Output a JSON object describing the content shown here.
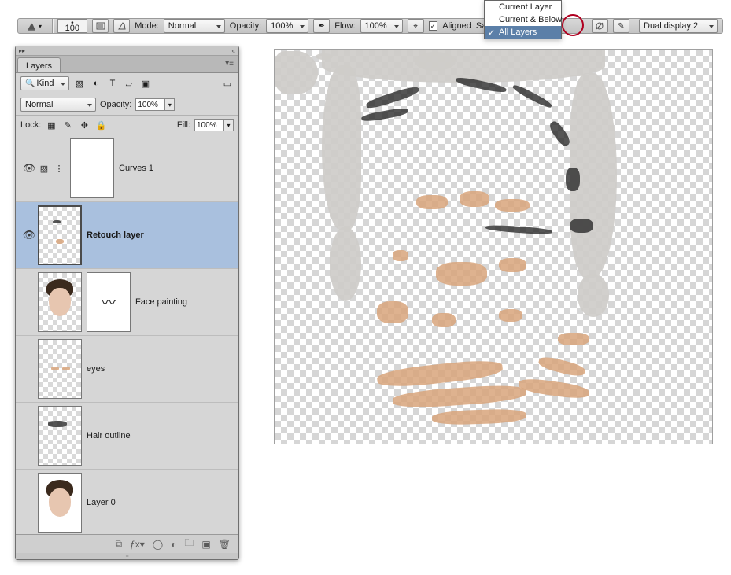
{
  "options_bar": {
    "brush_size": "100",
    "mode_label": "Mode:",
    "mode_value": "Normal",
    "opacity_label": "Opacity:",
    "opacity_value": "100%",
    "flow_label": "Flow:",
    "flow_value": "100%",
    "aligned_checked": true,
    "aligned_label": "Aligned",
    "sample_label": "Sample:",
    "sample_value": "All Layers",
    "sample_options": [
      "Current Layer",
      "Current & Below",
      "All Layers"
    ],
    "display_select": "Dual display 2"
  },
  "layers_panel": {
    "tab_label": "Layers",
    "filter": {
      "kind_label": "Kind",
      "icons": [
        "image",
        "adjust",
        "text",
        "shape",
        "smart"
      ]
    },
    "blend": {
      "mode": "Normal",
      "opacity_label": "Opacity:",
      "opacity_value": "100%"
    },
    "lock": {
      "label": "Lock:",
      "fill_label": "Fill:",
      "fill_value": "100%"
    },
    "layers": [
      {
        "name": "Curves 1",
        "visible": true,
        "type": "adjustment",
        "mask": true
      },
      {
        "name": "Retouch layer",
        "visible": true,
        "type": "pixel",
        "bold": true,
        "active": true
      },
      {
        "name": "Face painting",
        "visible": false,
        "type": "pixel",
        "mask": true
      },
      {
        "name": "eyes",
        "visible": false,
        "type": "pixel"
      },
      {
        "name": "Hair outline",
        "visible": false,
        "type": "pixel"
      },
      {
        "name": "Layer 0",
        "visible": false,
        "type": "pixel"
      }
    ]
  },
  "highlight": {
    "circled_tool": "ignore-adjustment-layers-toggle"
  }
}
